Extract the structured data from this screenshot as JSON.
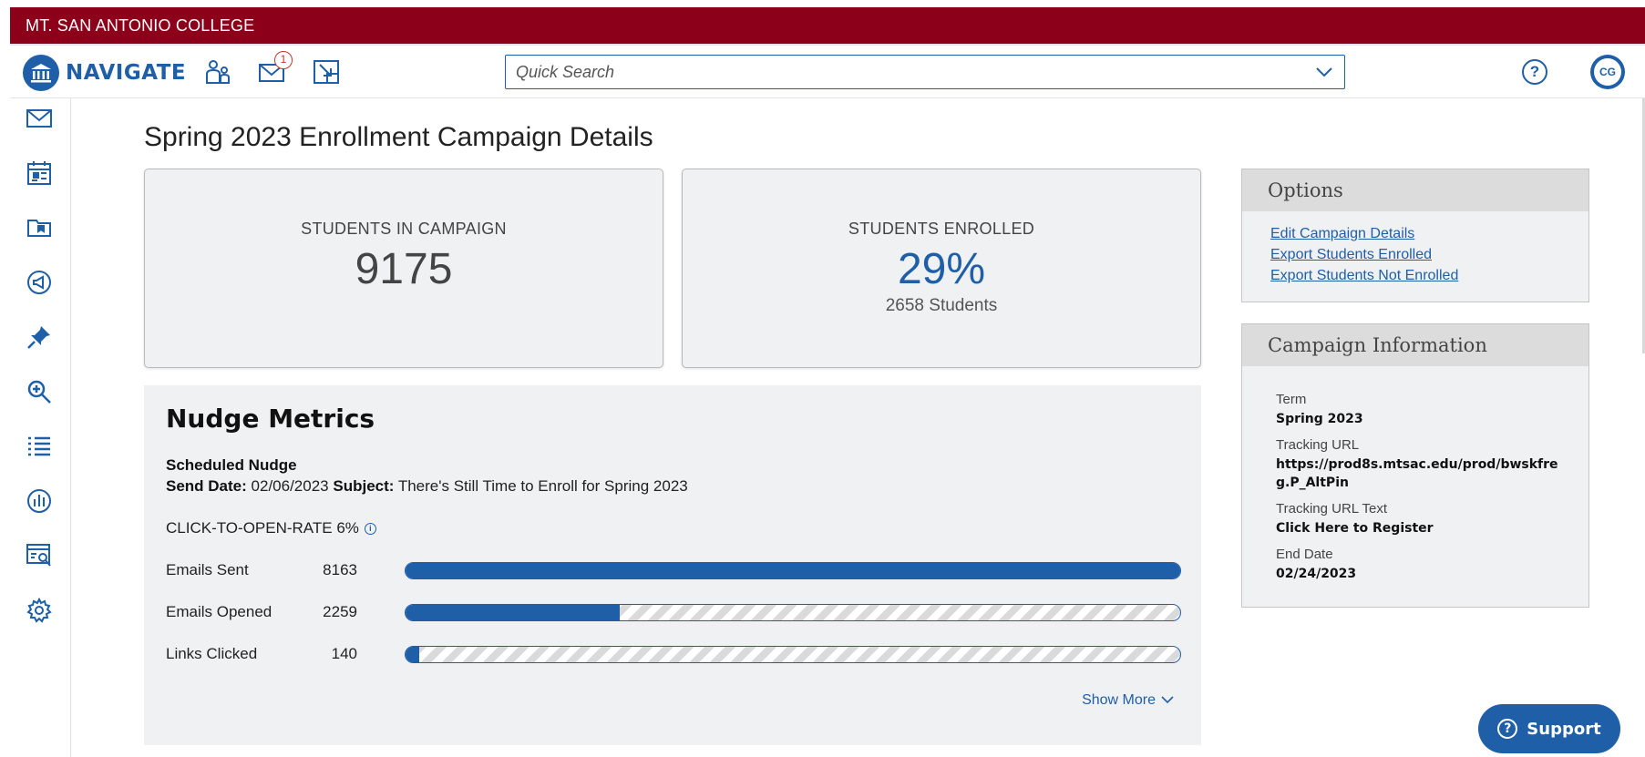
{
  "college": {
    "name": "MT. SAN ANTONIO COLLEGE"
  },
  "nav": {
    "logo_text": "NAVIGATE",
    "message_badge": "1",
    "search_placeholder": "Quick Search",
    "help_label": "?",
    "avatar_initials": "CG"
  },
  "colors": {
    "brand": "#8c0019",
    "accent": "#1f5fa8",
    "panel": "#f0f1f3"
  },
  "sidebar": {
    "items": [
      {
        "icon": "mail-icon"
      },
      {
        "icon": "calendar-icon"
      },
      {
        "icon": "folder-icon"
      },
      {
        "icon": "megaphone-icon"
      },
      {
        "icon": "pin-icon"
      },
      {
        "icon": "search-plus-icon"
      },
      {
        "icon": "list-icon"
      },
      {
        "icon": "chart-icon"
      },
      {
        "icon": "report-search-icon"
      },
      {
        "icon": "gear-icon"
      }
    ]
  },
  "page": {
    "title": "Spring 2023 Enrollment Campaign Details"
  },
  "cards": {
    "in_campaign": {
      "label": "STUDENTS IN CAMPAIGN",
      "value": "9175"
    },
    "enrolled": {
      "label": "STUDENTS ENROLLED",
      "value": "29%",
      "sub": "2658 Students"
    }
  },
  "nudge": {
    "title": "Nudge Metrics",
    "scheduled_label": "Scheduled Nudge",
    "send_date_label": "Send Date:",
    "send_date": "02/06/2023",
    "subject_label": "Subject:",
    "subject": "There's Still Time to Enroll for Spring 2023",
    "ctor_label": "CLICK-TO-OPEN-RATE 6%",
    "metrics": [
      {
        "label": "Emails Sent",
        "value": "8163",
        "fraction": 1.0
      },
      {
        "label": "Emails Opened",
        "value": "2259",
        "fraction": 0.2767
      },
      {
        "label": "Links Clicked",
        "value": "140",
        "fraction": 0.0172
      }
    ],
    "show_more": "Show More"
  },
  "options": {
    "title": "Options",
    "links": [
      "Edit Campaign Details",
      "Export Students Enrolled",
      "Export Students Not Enrolled"
    ]
  },
  "campaign_info": {
    "title": "Campaign Information",
    "term_label": "Term",
    "term": "Spring 2023",
    "url_label": "Tracking URL",
    "url": "https://prod8s.mtsac.edu/prod/bwskfreg.P_AltPin",
    "url_text_label": "Tracking URL Text",
    "url_text": "Click Here to Register",
    "end_label": "End Date",
    "end_date": "02/24/2023"
  },
  "support": {
    "label": "Support"
  }
}
